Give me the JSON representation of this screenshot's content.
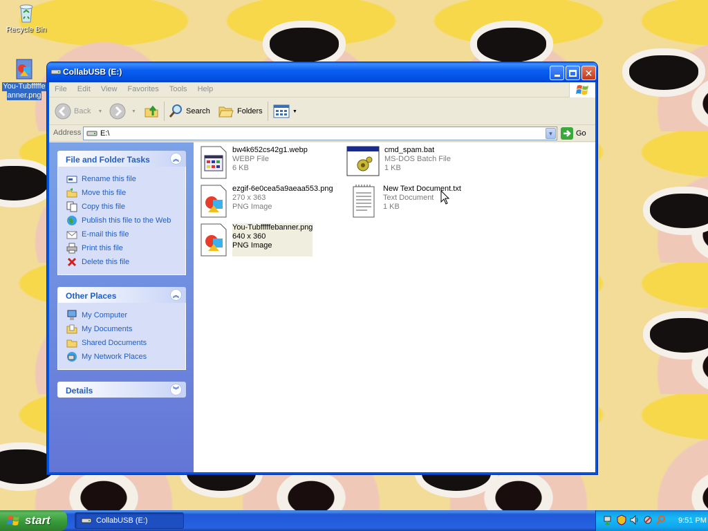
{
  "desktop": {
    "icons": [
      {
        "label": "Recycle Bin",
        "icon": "recycle-bin-icon"
      },
      {
        "label": "You-Tubfffffebanner.png",
        "label_line1": "You-Tubfffffe",
        "label_line2": "anner.png",
        "icon": "png-image-icon"
      }
    ]
  },
  "window": {
    "title": "CollabUSB (E:)",
    "controls": {
      "minimize": "minimize",
      "maximize": "maximize",
      "close": "close"
    }
  },
  "menubar": {
    "items": [
      "File",
      "Edit",
      "View",
      "Favorites",
      "Tools",
      "Help"
    ]
  },
  "toolbar": {
    "back": "Back",
    "search": "Search",
    "folders": "Folders"
  },
  "addressbar": {
    "label": "Address",
    "value": "E:\\",
    "go": "Go"
  },
  "taskpane": {
    "file_folder_tasks": {
      "title": "File and Folder Tasks",
      "items": [
        {
          "label": "Rename this file",
          "icon": "rename-icon"
        },
        {
          "label": "Move this file",
          "icon": "move-icon"
        },
        {
          "label": "Copy this file",
          "icon": "copy-icon"
        },
        {
          "label": "Publish this file to the Web",
          "icon": "publish-web-icon"
        },
        {
          "label": "E-mail this file",
          "icon": "email-icon"
        },
        {
          "label": "Print this file",
          "icon": "print-icon"
        },
        {
          "label": "Delete this file",
          "icon": "delete-icon"
        }
      ]
    },
    "other_places": {
      "title": "Other Places",
      "items": [
        {
          "label": "My Computer",
          "icon": "my-computer-icon"
        },
        {
          "label": "My Documents",
          "icon": "my-documents-icon"
        },
        {
          "label": "Shared Documents",
          "icon": "shared-documents-icon"
        },
        {
          "label": "My Network Places",
          "icon": "network-places-icon"
        }
      ]
    },
    "details": {
      "title": "Details"
    }
  },
  "files": [
    {
      "name": "bw4k652cs42g1.webp",
      "type": "WEBP File",
      "info": "6 KB",
      "icon": "webp-file-icon",
      "selected": false
    },
    {
      "name": "cmd_spam.bat",
      "type": "MS-DOS Batch File",
      "info": "1 KB",
      "icon": "batch-file-icon",
      "selected": false
    },
    {
      "name": "ezgif-6e0cea5a9aeaa553.png",
      "type": "270 x 363",
      "info": "PNG Image",
      "icon": "png-image-icon",
      "selected": false
    },
    {
      "name": "New Text Document.txt",
      "type": "Text Document",
      "info": "1 KB",
      "icon": "text-document-icon",
      "selected": false
    },
    {
      "name": "You-Tubfffffebanner.png",
      "type": "640 x 360",
      "info": "PNG Image",
      "icon": "png-image-icon",
      "selected": true
    }
  ],
  "taskbar": {
    "start": "start",
    "active_task": "CollabUSB (E:)",
    "clock": "9:51 PM"
  }
}
